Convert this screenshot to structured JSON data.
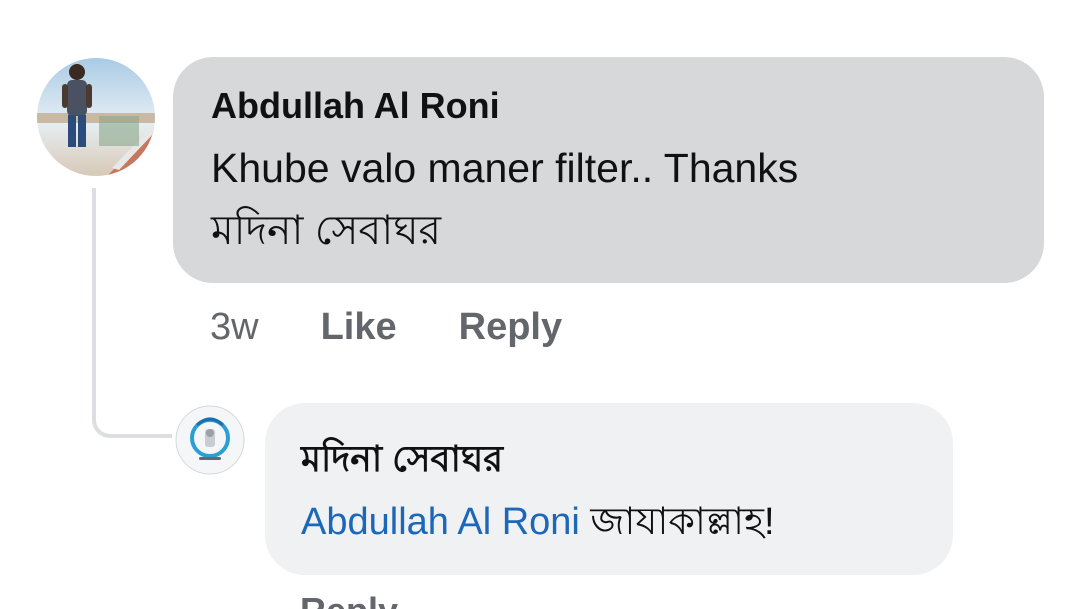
{
  "comment": {
    "author": "Abdullah Al Roni",
    "lines": [
      "Khube valo maner filter.. Thanks",
      "মদিনা সেবাঘর"
    ],
    "time": "3w",
    "like_label": "Like",
    "reply_label": "Reply"
  },
  "reply": {
    "author": "মদিনা সেবাঘর",
    "mention": "Abdullah Al Roni",
    "text": "জাযাকাল্লাহ!",
    "cut_label": "Reply"
  },
  "colors": {
    "main_bubble": "#d7d8da",
    "reply_bubble": "#f0f1f3",
    "mention": "#1b67b8",
    "meta_text": "#63666b",
    "thread_line": "#dcdee2"
  },
  "icons": {
    "main_avatar": "user-photo-avatar",
    "reply_avatar": "page-logo-avatar"
  }
}
